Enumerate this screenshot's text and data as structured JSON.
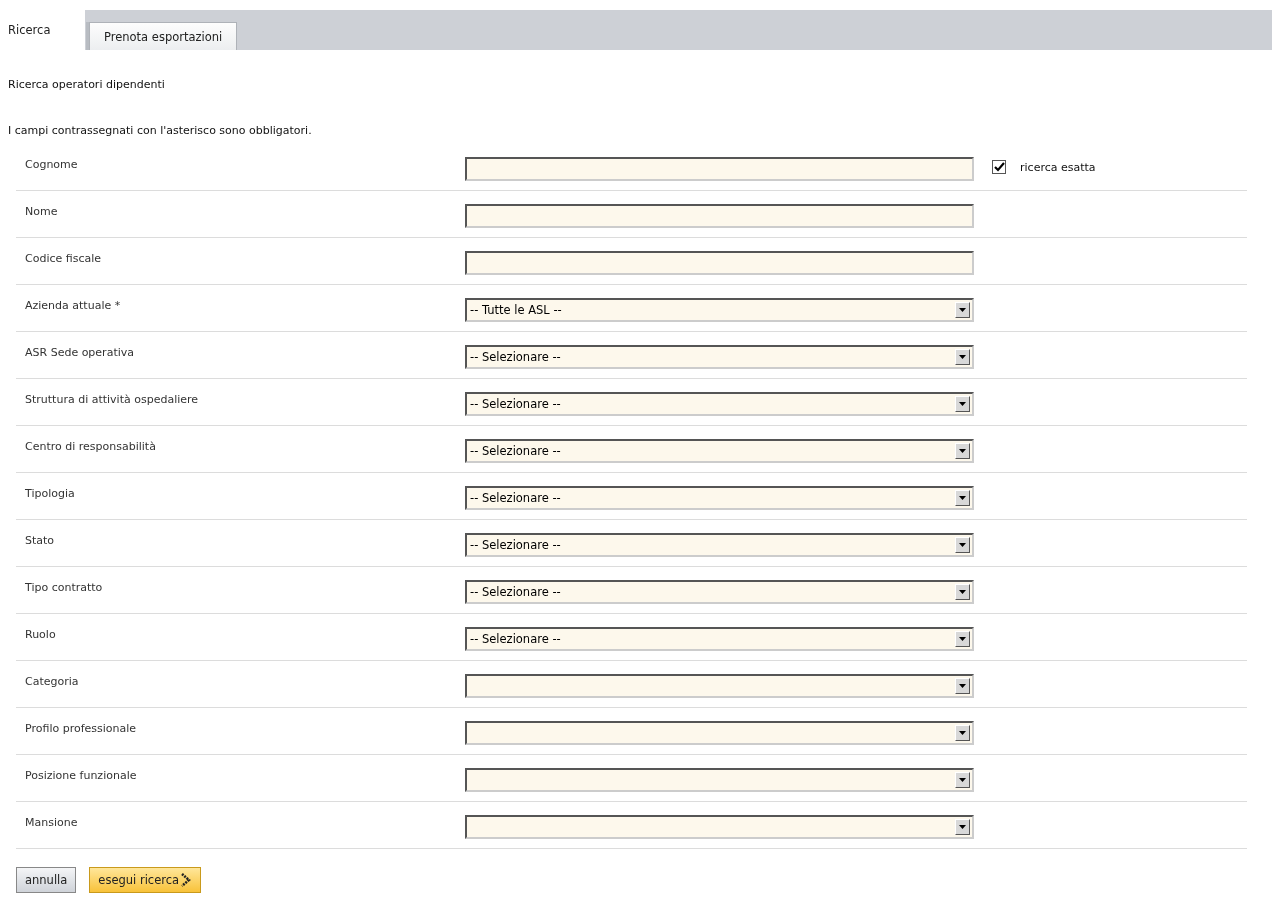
{
  "tabs": [
    {
      "label": "Ricerca",
      "selected": true
    },
    {
      "label": "Prenota esportazioni",
      "selected": false
    }
  ],
  "title": "Ricerca operatori dipendenti",
  "note": "I campi contrassegnati con l'asterisco sono obbligatori.",
  "fields": [
    {
      "kind": "text",
      "label": "Cognome",
      "option": {
        "label": "ricerca esatta",
        "checked": true
      }
    },
    {
      "kind": "text",
      "label": "Nome"
    },
    {
      "kind": "text",
      "label": "Codice fiscale"
    },
    {
      "kind": "select",
      "label": "Azienda attuale *",
      "value": "-- Tutte le ASL --"
    },
    {
      "kind": "select",
      "label": "ASR Sede operativa",
      "value": "-- Selezionare --"
    },
    {
      "kind": "select",
      "label": "Struttura di attività ospedaliere",
      "value": "-- Selezionare --"
    },
    {
      "kind": "select",
      "label": "Centro di responsabilità",
      "value": "-- Selezionare --"
    },
    {
      "kind": "select",
      "label": "Tipologia",
      "value": "-- Selezionare --"
    },
    {
      "kind": "select",
      "label": "Stato",
      "value": "-- Selezionare --"
    },
    {
      "kind": "select",
      "label": "Tipo contratto",
      "value": "-- Selezionare --"
    },
    {
      "kind": "select",
      "label": "Ruolo",
      "value": "-- Selezionare --"
    },
    {
      "kind": "select",
      "label": "Categoria"
    },
    {
      "kind": "select",
      "label": "Profilo professionale"
    },
    {
      "kind": "select",
      "label": "Posizione funzionale"
    },
    {
      "kind": "select",
      "label": "Mansione"
    }
  ],
  "buttons": [
    {
      "kind": "plain",
      "label": "annulla"
    },
    {
      "kind": "primary",
      "label": "esegui ricerca"
    }
  ]
}
